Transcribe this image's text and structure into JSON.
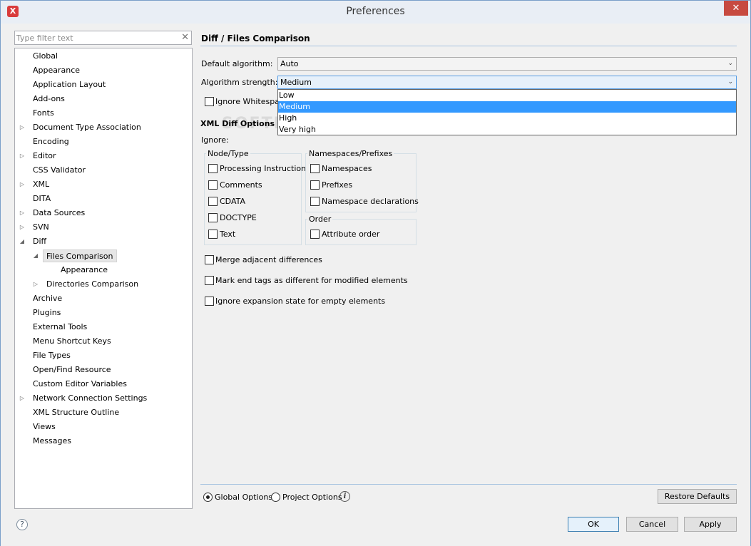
{
  "window": {
    "title": "Preferences",
    "close_glyph": "✕",
    "app_icon_glyph": "X"
  },
  "filter": {
    "placeholder": "Type filter text",
    "clear_glyph": "✕"
  },
  "tree": [
    {
      "label": "Global",
      "depth": 0,
      "arrow": ""
    },
    {
      "label": "Appearance",
      "depth": 0,
      "arrow": ""
    },
    {
      "label": "Application Layout",
      "depth": 0,
      "arrow": ""
    },
    {
      "label": "Add-ons",
      "depth": 0,
      "arrow": ""
    },
    {
      "label": "Fonts",
      "depth": 0,
      "arrow": ""
    },
    {
      "label": "Document Type Association",
      "depth": 0,
      "arrow": "collapsed"
    },
    {
      "label": "Encoding",
      "depth": 0,
      "arrow": ""
    },
    {
      "label": "Editor",
      "depth": 0,
      "arrow": "collapsed"
    },
    {
      "label": "CSS Validator",
      "depth": 0,
      "arrow": ""
    },
    {
      "label": "XML",
      "depth": 0,
      "arrow": "collapsed"
    },
    {
      "label": "DITA",
      "depth": 0,
      "arrow": ""
    },
    {
      "label": "Data Sources",
      "depth": 0,
      "arrow": "collapsed"
    },
    {
      "label": "SVN",
      "depth": 0,
      "arrow": "collapsed"
    },
    {
      "label": "Diff",
      "depth": 0,
      "arrow": "expanded"
    },
    {
      "label": "Files Comparison",
      "depth": 1,
      "arrow": "expanded",
      "selected": true
    },
    {
      "label": "Appearance",
      "depth": 2,
      "arrow": ""
    },
    {
      "label": "Directories Comparison",
      "depth": 1,
      "arrow": "collapsed"
    },
    {
      "label": "Archive",
      "depth": 0,
      "arrow": ""
    },
    {
      "label": "Plugins",
      "depth": 0,
      "arrow": ""
    },
    {
      "label": "External Tools",
      "depth": 0,
      "arrow": ""
    },
    {
      "label": "Menu Shortcut Keys",
      "depth": 0,
      "arrow": ""
    },
    {
      "label": "File Types",
      "depth": 0,
      "arrow": ""
    },
    {
      "label": "Open/Find Resource",
      "depth": 0,
      "arrow": ""
    },
    {
      "label": "Custom Editor Variables",
      "depth": 0,
      "arrow": ""
    },
    {
      "label": "Network Connection Settings",
      "depth": 0,
      "arrow": "collapsed"
    },
    {
      "label": "XML Structure Outline",
      "depth": 0,
      "arrow": ""
    },
    {
      "label": "Views",
      "depth": 0,
      "arrow": ""
    },
    {
      "label": "Messages",
      "depth": 0,
      "arrow": ""
    }
  ],
  "page": {
    "title": "Diff / Files Comparison",
    "default_algorithm_label": "Default algorithm:",
    "default_algorithm_value": "Auto",
    "algorithm_strength_label": "Algorithm strength:",
    "algorithm_strength_value": "Medium",
    "strength_options": [
      "Low",
      "Medium",
      "High",
      "Very high"
    ],
    "strength_selected_index": 1,
    "ignore_whitespace_label": "Ignore Whitespace",
    "xml_diff_options_label": "XML Diff Options",
    "ignore_label": "Ignore:",
    "node_type_group": "Node/Type",
    "node_type_items": [
      "Processing Instruction",
      "Comments",
      "CDATA",
      "DOCTYPE",
      "Text"
    ],
    "namespaces_group": "Namespaces/Prefixes",
    "namespaces_items": [
      "Namespaces",
      "Prefixes",
      "Namespace declarations"
    ],
    "order_group": "Order",
    "order_items": [
      "Attribute order"
    ],
    "merge_adjacent_label": "Merge adjacent differences",
    "mark_end_tags_label": "Mark end tags as different for modified elements",
    "ignore_expansion_label": "Ignore expansion state for empty elements",
    "global_options_label": "Global Options",
    "project_options_label": "Project Options",
    "restore_defaults_label": "Restore Defaults"
  },
  "footer": {
    "ok_label": "OK",
    "cancel_label": "Cancel",
    "apply_label": "Apply",
    "help_glyph": "?"
  },
  "watermark": "SOFTPEDIA",
  "icons": {
    "info": "i",
    "dropdown_arrow": "⌄",
    "tree_collapsed": "▷",
    "tree_expanded": "◢"
  }
}
